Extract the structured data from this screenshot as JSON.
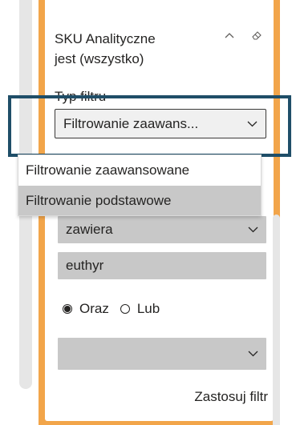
{
  "filter_card": {
    "title_line1": "SKU Analityczne",
    "title_line2": "jest (wszystko)",
    "filter_type_label": "Typ filtru",
    "filter_type_selected": "Filtrowanie zaawans...",
    "filter_type_options": [
      "Filtrowanie zaawansowane",
      "Filtrowanie podstawowe"
    ],
    "condition_operator": "zawiera",
    "condition_value": "euthyr",
    "logic_options": [
      "Oraz",
      "Lub"
    ],
    "logic_selected": "Oraz",
    "second_operator": "",
    "apply_label": "Zastosuj filtr"
  },
  "colors": {
    "card_border": "#f2a54a",
    "focus_frame": "#1f4e68",
    "field_bg": "#c8c8c8",
    "highlight": "#c8c8c8"
  },
  "icons": {
    "collapse": "chevron-up-icon",
    "clear": "eraser-icon",
    "dropdown": "chevron-down-icon"
  }
}
